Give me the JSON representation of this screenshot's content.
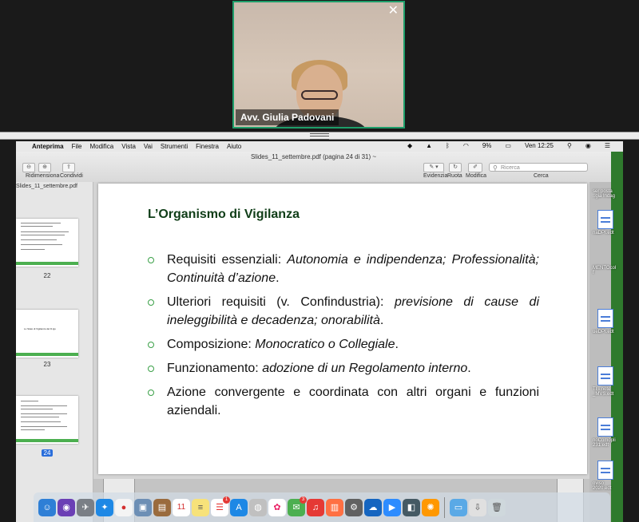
{
  "meeting": {
    "participant_name": "Avv. Giulia Padovani",
    "close_glyph": "✕"
  },
  "menubar": {
    "apple_glyph": "",
    "items": [
      "Anteprima",
      "File",
      "Modifica",
      "Vista",
      "Vai",
      "Strumenti",
      "Finestra",
      "Aiuto"
    ],
    "battery": "9%",
    "clock": "Ven 12:25"
  },
  "toolbar": {
    "document_title": "Slides_11_settembre.pdf (pagina 24 di 31) ~",
    "left_labels": [
      "Ridimensiona",
      "Condividi"
    ],
    "right_labels": [
      "Evidenzia",
      "Ruota",
      "Modifica"
    ],
    "search_placeholder": "Ricerca",
    "search_label": "Cerca"
  },
  "sidebar": {
    "file_name": "Slides_11_settembre.pdf",
    "pages": [
      "22",
      "23",
      "24"
    ],
    "thumb_23_title": "Lo Stato di Vigilanza del D.lgs"
  },
  "slide": {
    "title": "L’Organismo di Vigilanza",
    "bullets": [
      {
        "normal": "Requisiti essenziali: ",
        "italic": "Autonomia e indipendenza; Professionalità; Continuità d’azione",
        "tail": "."
      },
      {
        "normal": "Ulteriori requisiti (v. Confindustria): ",
        "italic": "previsione di cause di ineleggibilità e decadenza; onorabilità",
        "tail": "."
      },
      {
        "normal": "Composizione: ",
        "italic": "Monocratico o Collegiale",
        "tail": "."
      },
      {
        "normal": "Funzionamento: ",
        "italic": "adozione di un Regolamento interno",
        "tail": "."
      },
      {
        "normal": "Azione convergente e coordinata con altri organi e funzioni aziendali.",
        "italic": "",
        "tail": ""
      }
    ]
  },
  "desktop": {
    "files": [
      "ser posta ..gia Indag",
      "naDPI.edt",
      "MENTOcol f",
      "ueDPI.edt",
      "TI - note _MVS.edt",
      "noComopli 231.edt",
      "oviso 2020.edt"
    ]
  },
  "dock": {
    "calendar_day": "11",
    "badges": {
      "reminders": "1",
      "mail": "3"
    }
  }
}
